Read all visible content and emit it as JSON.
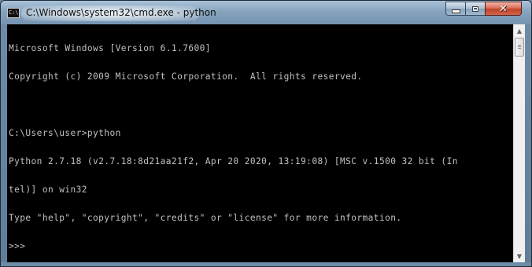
{
  "window": {
    "title": "C:\\Windows\\system32\\cmd.exe - python",
    "icon": "cmd-console-icon",
    "icon_glyph": "C:\\"
  },
  "controls": {
    "minimize_icon": "minimize-icon",
    "maximize_icon": "maximize-icon",
    "close_icon": "close-icon",
    "close_glyph": "✕"
  },
  "console": {
    "background": "#000000",
    "foreground": "#c0c0c0",
    "lines": [
      "Microsoft Windows [Version 6.1.7600]",
      "Copyright (c) 2009 Microsoft Corporation.  All rights reserved.",
      "",
      "C:\\Users\\user>python",
      "Python 2.7.18 (v2.7.18:8d21aa21f2, Apr 20 2020, 13:19:08) [MSC v.1500 32 bit (In",
      "tel)] on win32",
      "Type \"help\", \"copyright\", \"credits\" or \"license\" for more information.",
      ">>>"
    ]
  },
  "scrollbar": {
    "up_arrow": "▲",
    "down_arrow": "▼"
  }
}
